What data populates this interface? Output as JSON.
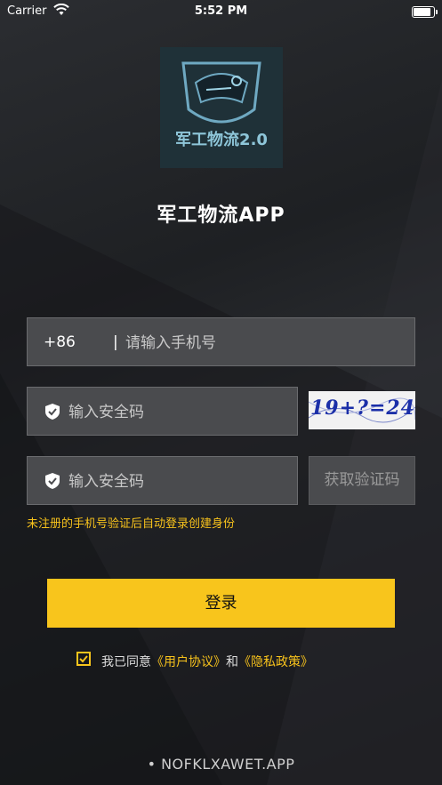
{
  "status_bar": {
    "carrier": "Carrier",
    "time": "5:52 PM",
    "battery_level": 1.0
  },
  "logo": {
    "text": "军工物流2.0",
    "accent_color": "#8ec6d9"
  },
  "app_title": "军工物流APP",
  "phone": {
    "country_code": "+86",
    "separator": "|",
    "placeholder": "请输入手机号"
  },
  "security_code": {
    "placeholder": "输入安全码",
    "icon": "shield-check-icon"
  },
  "captcha": {
    "text": "19+?=24"
  },
  "sms_code": {
    "placeholder": "输入安全码",
    "button_label": "获取验证码",
    "icon": "shield-check-icon"
  },
  "hint": "未注册的手机号验证后自动登录创建身份",
  "login_button": "登录",
  "agreement": {
    "checked": true,
    "prefix": "我已同意",
    "user_agreement": "《用户协议》",
    "conjunction": "和",
    "privacy_policy": "《隐私政策》"
  },
  "footer": "• NOFKLXAWET.APP",
  "colors": {
    "accent": "#f8c51c",
    "field_bg": "#4a4b4e",
    "background": "#1e2023"
  }
}
